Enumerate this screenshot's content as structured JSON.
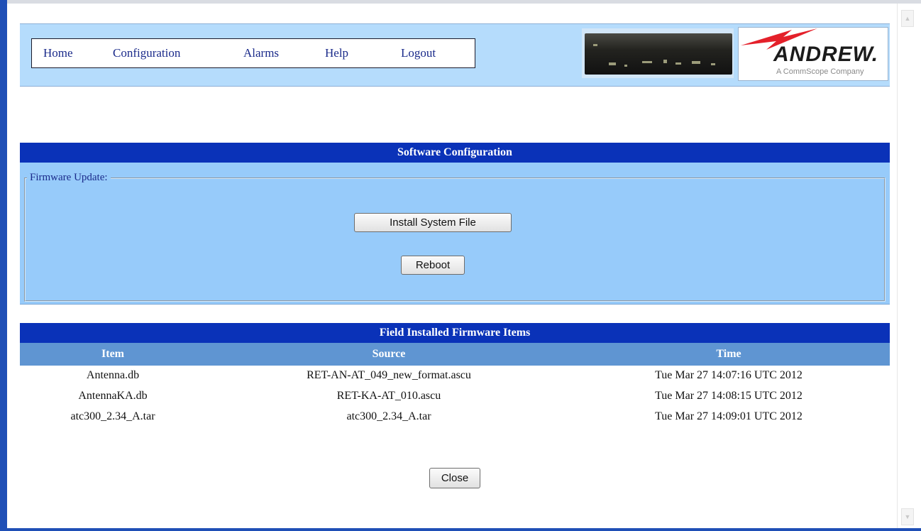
{
  "nav": {
    "items": [
      {
        "label": "Home"
      },
      {
        "label": "Configuration"
      },
      {
        "label": "Alarms"
      },
      {
        "label": "Help"
      },
      {
        "label": "Logout"
      }
    ]
  },
  "logo": {
    "brand": "ANDREW.",
    "tagline": "A CommScope Company"
  },
  "software_config": {
    "title": "Software Configuration",
    "firmware_legend": "Firmware Update:",
    "install_button": "Install System File",
    "reboot_button": "Reboot"
  },
  "firmware_table": {
    "title": "Field Installed Firmware Items",
    "columns": [
      "Item",
      "Source",
      "Time"
    ],
    "rows": [
      {
        "item": "Antenna.db",
        "source": "RET-AN-AT_049_new_format.ascu",
        "time": "Tue Mar 27 14:07:16 UTC 2012"
      },
      {
        "item": "AntennaKA.db",
        "source": "RET-KA-AT_010.ascu",
        "time": "Tue Mar 27 14:08:15 UTC 2012"
      },
      {
        "item": "atc300_2.34_A.tar",
        "source": "atc300_2.34_A.tar",
        "time": "Tue Mar 27 14:09:01 UTC 2012"
      }
    ]
  },
  "close_button": "Close",
  "colors": {
    "header_band": "#b5dcfc",
    "section_bar": "#0a32b8",
    "panel": "#97cbfa",
    "column_header": "#5f95d2",
    "logo_red": "#e4202a"
  },
  "icons": {
    "scroll_up": "scroll-up-arrow-icon",
    "scroll_down": "scroll-down-arrow-icon",
    "logo_mark": "andrew-bolt-logo-icon"
  }
}
